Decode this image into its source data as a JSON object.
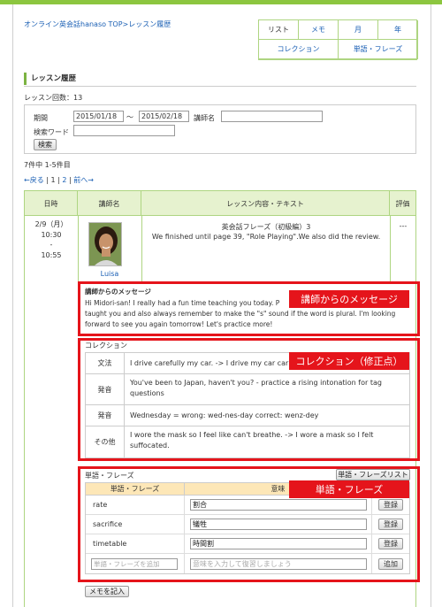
{
  "breadcrumb": "オンライン英会話hanaso TOP>レッスン履歴",
  "nav": {
    "list": "リスト",
    "memo": "メモ",
    "month": "月",
    "year": "年",
    "collection": "コレクション",
    "words": "単語・フレーズ"
  },
  "section_title": "レッスン履歴",
  "lesson_count": "レッスン回数：13",
  "search": {
    "period_label": "期間",
    "date_from": "2015/01/18",
    "tilde": "〜",
    "date_to": "2015/02/18",
    "teacher_label": "講師名",
    "teacher_value": "",
    "keyword_label": "検索ワード",
    "keyword_value": "",
    "search_button": "検索"
  },
  "result_count": "7件中 1-5件目",
  "pager": {
    "prev": "←戻る",
    "sep1": " | ",
    "page1": "1",
    "sep2": " | ",
    "page2": "2",
    "sep3": " | ",
    "next": "前へ→"
  },
  "table": {
    "col_date": "日時",
    "col_teacher": "講師名",
    "col_content": "レッスン内容・テキスト",
    "col_rating": "評価"
  },
  "lesson": {
    "date": "2/9（月）",
    "time_start": "10:30",
    "dash": "-",
    "time_end": "10:55",
    "teacher": "Luisa",
    "title": "英会話フレーズ（初級編）3",
    "note": "We finished until page 39, \"Role Playing\".We also did the review.",
    "rating": "---"
  },
  "message": {
    "heading": "講師からのメッセージ",
    "line1": "Hi Midori-san! I really had a fun time teaching you today. P",
    "line2": "taught you and also always remember to make the \"s\" sound if the word is plural. I'm looking",
    "line3": "forward to see you again tomorrow! Let's practice more!",
    "callout": "講師からのメッセージ"
  },
  "collection": {
    "heading": "コレクション",
    "callout": "コレクション（修正点）",
    "rows": [
      {
        "cat": "文法",
        "text": "I drive carefully my car. -> I drive my car car"
      },
      {
        "cat": "発音",
        "text": "You've been to Japan, haven't you? - practice a rising intonation for tag questions"
      },
      {
        "cat": "発音",
        "text": "Wednesday = wrong: wed-nes-day correct: wenz-dey"
      },
      {
        "cat": "その他",
        "text": "I wore the mask so I feel like can't breathe. -> I wore a mask so I felt suffocated."
      }
    ]
  },
  "words": {
    "heading": "単語・フレーズ",
    "list_button": "単語・フレーズリスト",
    "callout": "単語・フレーズ",
    "col_word": "単語・フレーズ",
    "col_meaning": "意味",
    "rows": [
      {
        "word": "rate",
        "meaning": "割合",
        "button": "登録"
      },
      {
        "word": "sacrifice",
        "meaning": "犠牲",
        "button": "登録"
      },
      {
        "word": "timetable",
        "meaning": "時間割",
        "button": "登録"
      }
    ],
    "add_word_placeholder": "単語・フレーズを追加",
    "add_meaning_placeholder": "意味を入力して復習しましょう",
    "add_button": "追加"
  },
  "memo_button": "メモを記入",
  "colors": {
    "green": "#8cc63f",
    "header_green": "#e6f2cf",
    "red": "#e5141b",
    "link": "#1a5fb4",
    "word_header": "#fde7b7"
  }
}
